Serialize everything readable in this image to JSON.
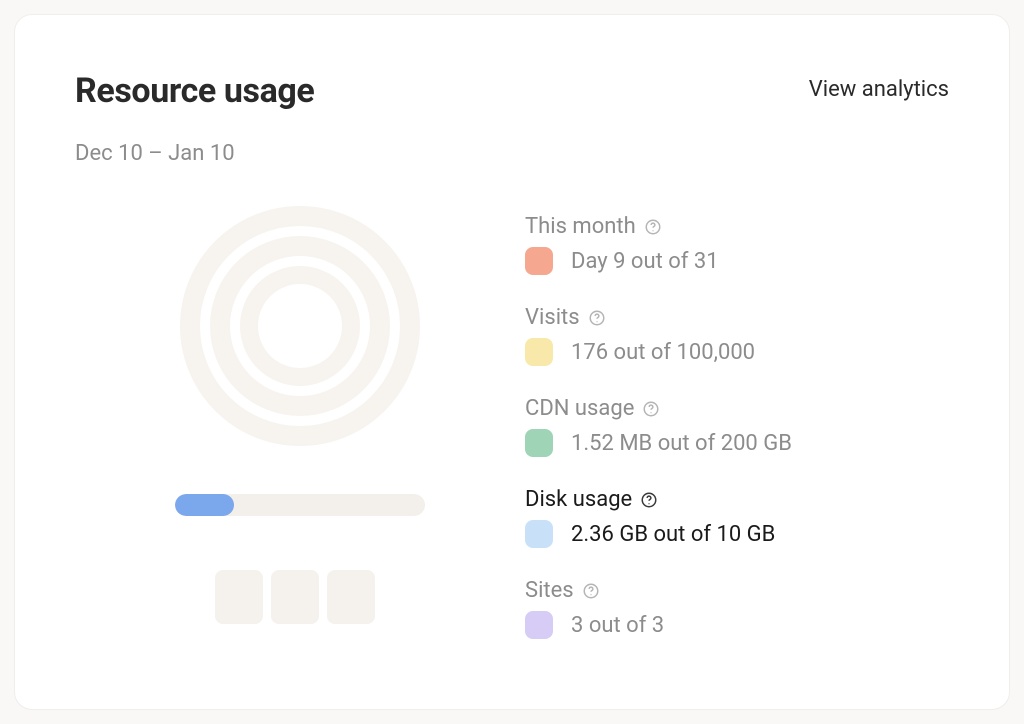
{
  "header": {
    "title": "Resource usage",
    "analytics_link": "View analytics",
    "date_range": "Dec 10 – Jan 10"
  },
  "disk_bar": {
    "percent": 23.6
  },
  "metrics": [
    {
      "key": "month",
      "label": "This month",
      "value": "Day 9 out of 31",
      "color": "#f5a88f",
      "active": false
    },
    {
      "key": "visits",
      "label": "Visits",
      "value": "176 out of 100,000",
      "color": "#f8e8a9",
      "active": false
    },
    {
      "key": "cdn",
      "label": "CDN usage",
      "value": "1.52 MB out of 200 GB",
      "color": "#9fd4b6",
      "active": false
    },
    {
      "key": "disk",
      "label": "Disk usage",
      "value": "2.36 GB out of 10 GB",
      "color": "#c8e1f9",
      "active": true
    },
    {
      "key": "sites",
      "label": "Sites",
      "value": "3 out of 3",
      "color": "#d6ccf5",
      "active": false
    }
  ]
}
